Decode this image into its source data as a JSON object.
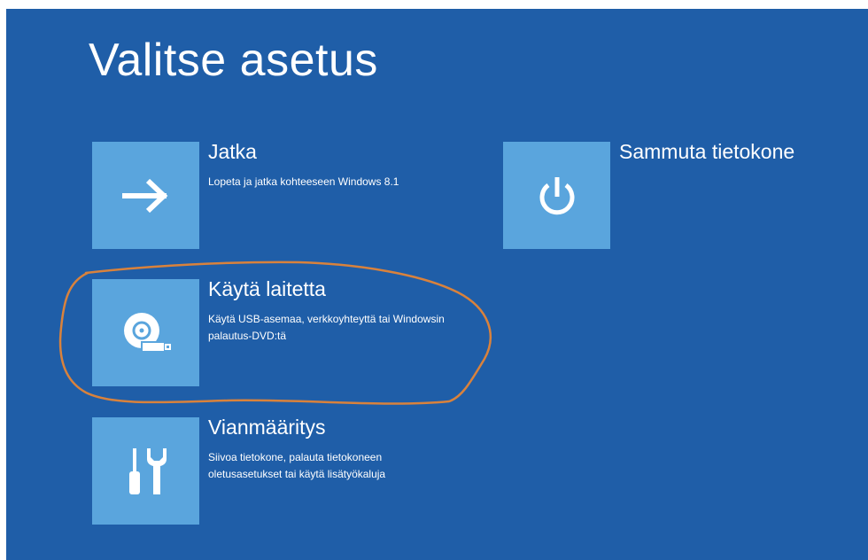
{
  "page": {
    "title": "Valitse asetus"
  },
  "options": [
    {
      "title": "Jatka",
      "description": "Lopeta ja jatka kohteeseen Windows 8.1",
      "icon": "arrow-right-icon"
    },
    {
      "title": "Sammuta tietokone",
      "description": "",
      "icon": "power-icon"
    },
    {
      "title": "Käytä laitetta",
      "description": "Käytä USB-asemaa, verkkoyhteyttä tai Windowsin palautus-DVD:tä",
      "icon": "disc-usb-icon",
      "highlighted": true
    },
    {
      "title": "Vianmääritys",
      "description": "Siivoa tietokone, palauta tietokoneen oletusasetukset tai käytä lisätyökaluja",
      "icon": "tools-icon"
    }
  ],
  "colors": {
    "background": "#1f5ea8",
    "tile": "#5aa5dd",
    "text": "#ffffff",
    "highlight_outline": "#d9823c",
    "border": "#ffffff"
  }
}
